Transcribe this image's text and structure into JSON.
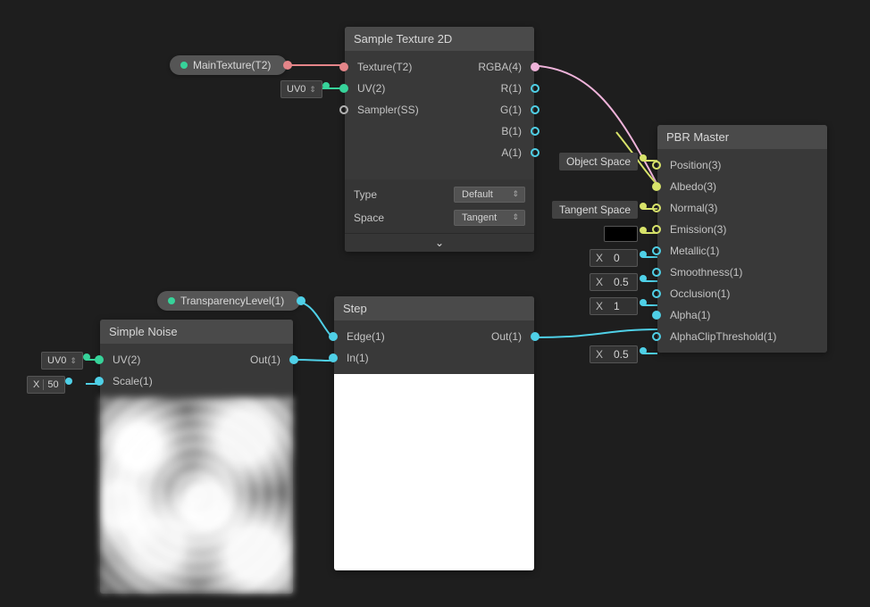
{
  "propertyPills": {
    "mainTexture": {
      "label": "MainTexture(T2)"
    },
    "transparencyLevel": {
      "label": "TransparencyLevel(1)"
    }
  },
  "externalInputs": {
    "uv0_top": {
      "label": "UV0",
      "hasArrows": true
    },
    "uv0_noise": {
      "label": "UV0",
      "hasArrows": true
    },
    "scale_noise": {
      "prefix": "X",
      "value": "50"
    },
    "pbr_posSpace": {
      "label": "Object Space"
    },
    "pbr_normalSpace": {
      "label": "Tangent Space"
    },
    "pbr_emission_color": "#000000",
    "pbr_metallic": {
      "prefix": "X",
      "value": "0"
    },
    "pbr_smooth": {
      "prefix": "X",
      "value": "0.5"
    },
    "pbr_occ": {
      "prefix": "X",
      "value": "1"
    },
    "pbr_alphaclip": {
      "prefix": "X",
      "value": "0.5"
    }
  },
  "nodes": {
    "sampleTexture": {
      "title": "Sample Texture 2D",
      "inputs": {
        "texture": "Texture(T2)",
        "uv": "UV(2)",
        "sampler": "Sampler(SS)"
      },
      "outputs": {
        "rgba": "RGBA(4)",
        "r": "R(1)",
        "g": "G(1)",
        "b": "B(1)",
        "a": "A(1)"
      },
      "props": {
        "typeLabel": "Type",
        "typeValue": "Default",
        "spaceLabel": "Space",
        "spaceValue": "Tangent"
      }
    },
    "simpleNoise": {
      "title": "Simple Noise",
      "inputs": {
        "uv": "UV(2)",
        "scale": "Scale(1)"
      },
      "outputs": {
        "out": "Out(1)"
      }
    },
    "step": {
      "title": "Step",
      "inputs": {
        "edge": "Edge(1)",
        "in": "In(1)"
      },
      "outputs": {
        "out": "Out(1)"
      }
    },
    "pbr": {
      "title": "PBR Master",
      "inputs": {
        "position": "Position(3)",
        "albedo": "Albedo(3)",
        "normal": "Normal(3)",
        "emission": "Emission(3)",
        "metallic": "Metallic(1)",
        "smooth": "Smoothness(1)",
        "occ": "Occlusion(1)",
        "alpha": "Alpha(1)",
        "alphaclip": "AlphaClipThreshold(1)"
      }
    }
  }
}
